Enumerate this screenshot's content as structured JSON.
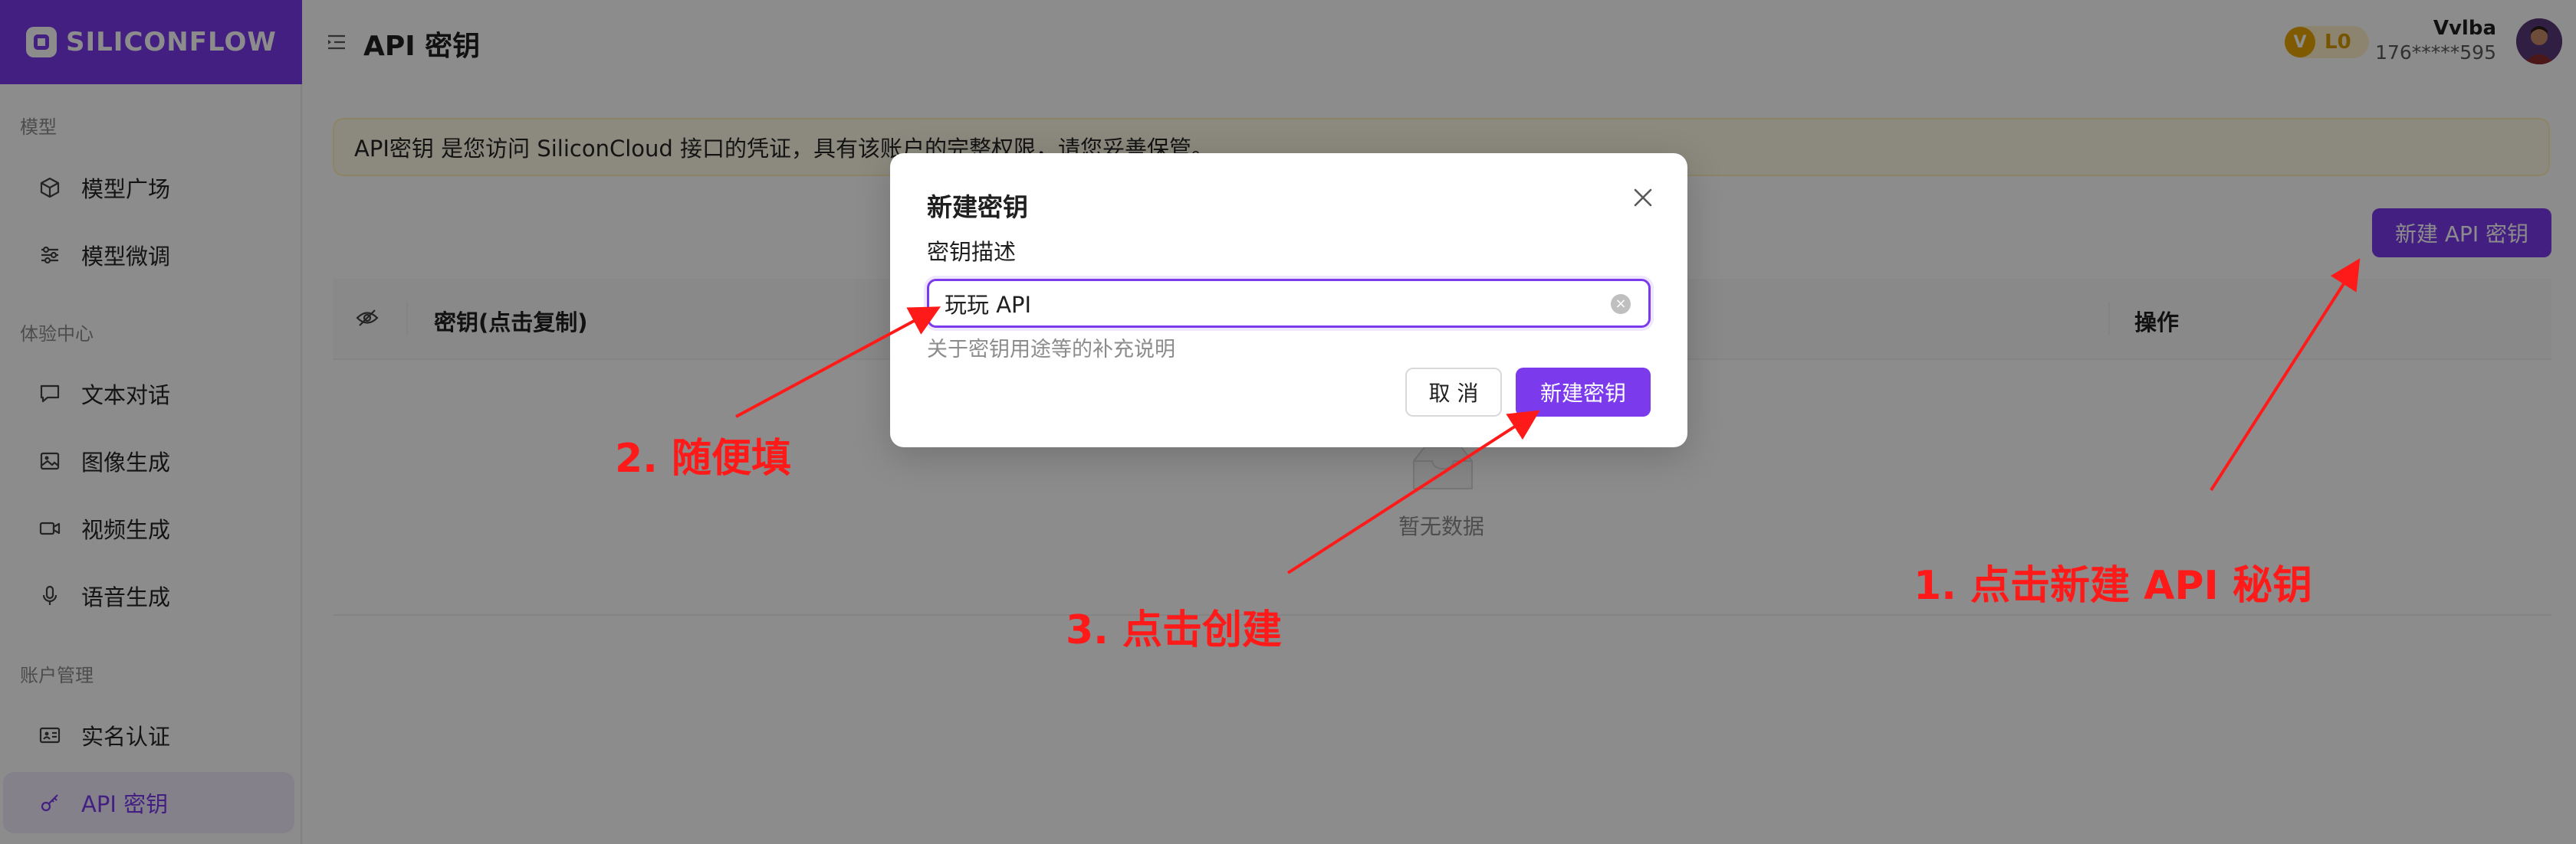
{
  "brand": {
    "name": "SILICONFLOW",
    "accent": "#7c3aed"
  },
  "sidebar": {
    "sections": [
      {
        "label": "模型",
        "items": [
          {
            "label": "模型广场",
            "icon": "cube-icon"
          },
          {
            "label": "模型微调",
            "icon": "sliders-icon"
          }
        ]
      },
      {
        "label": "体验中心",
        "items": [
          {
            "label": "文本对话",
            "icon": "chat-icon"
          },
          {
            "label": "图像生成",
            "icon": "image-icon"
          },
          {
            "label": "视频生成",
            "icon": "video-icon"
          },
          {
            "label": "语音生成",
            "icon": "microphone-icon"
          }
        ]
      },
      {
        "label": "账户管理",
        "items": [
          {
            "label": "实名认证",
            "icon": "id-card-icon"
          },
          {
            "label": "API 密钥",
            "icon": "key-icon",
            "active": true
          }
        ]
      }
    ]
  },
  "header": {
    "title": "API 密钥",
    "level_badge_letter": "V",
    "level_badge": "L0",
    "user_name": "Vvlba",
    "user_phone": "176*****595"
  },
  "main": {
    "notice": "API密钥 是您访问 SiliconCloud 接口的凭证，具有该账户的完整权限，请您妥善保管。",
    "new_key_button": "新建 API 密钥",
    "table": {
      "col_key": "密钥(点击复制)",
      "col_actions": "操作",
      "empty_text": "暂无数据"
    }
  },
  "modal": {
    "title": "新建密钥",
    "field_label": "密钥描述",
    "field_value": "玩玩 API",
    "field_help": "关于密钥用途等的补充说明",
    "cancel_label": "取 消",
    "create_label": "新建密钥"
  },
  "annotations": {
    "step1": "1. 点击新建 API 秘钥",
    "step2": "2. 随便填",
    "step3": "3. 点击创建",
    "color": "#ff1a1a"
  }
}
